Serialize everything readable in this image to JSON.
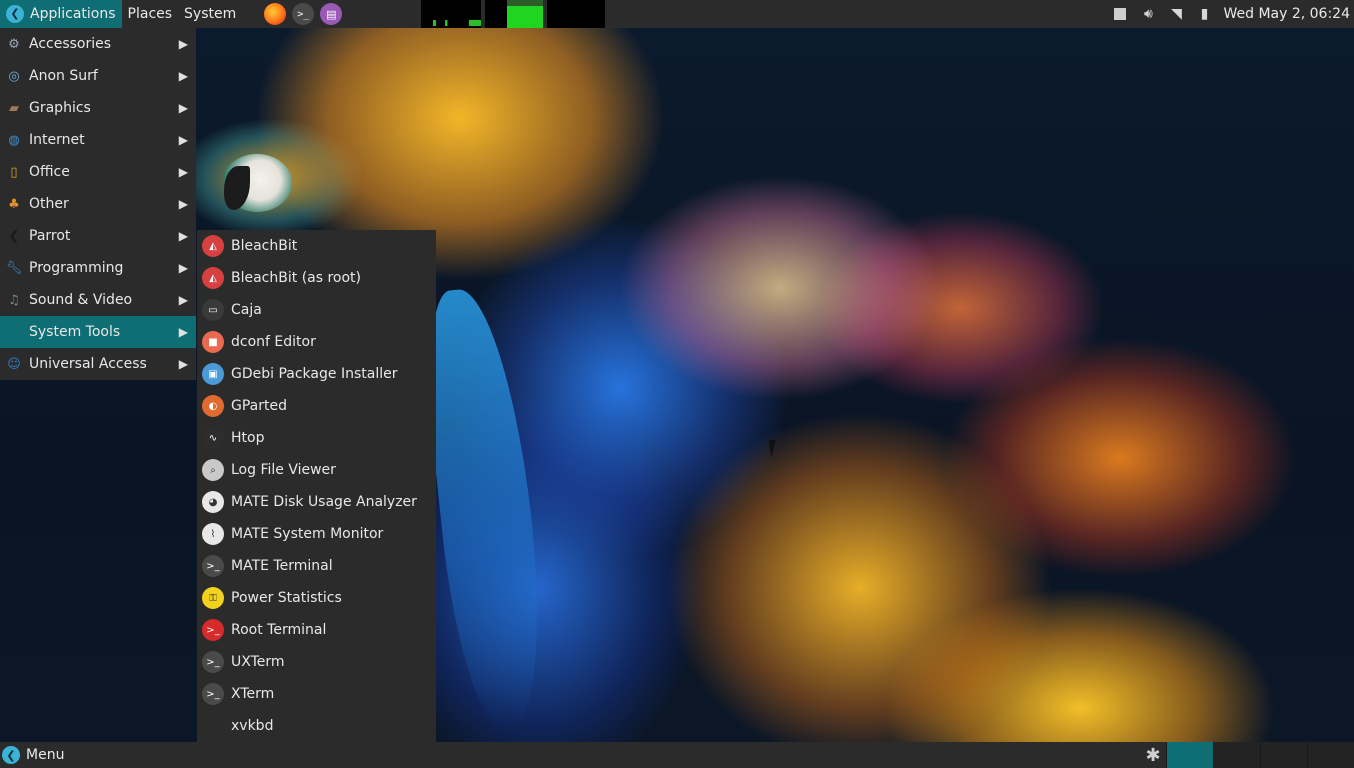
{
  "top_panel": {
    "menus": [
      "Applications",
      "Places",
      "System"
    ],
    "clock": "Wed May  2, 06:24"
  },
  "launchers": [
    "firefox-icon",
    "terminal-icon",
    "text-editor-icon"
  ],
  "app_menu": {
    "categories": [
      {
        "label": "Accessories",
        "icon": "accessories-icon",
        "color": "#9aa8b8"
      },
      {
        "label": "Anon Surf",
        "icon": "anonsurf-icon",
        "color": "#6fb0d8"
      },
      {
        "label": "Graphics",
        "icon": "graphics-icon",
        "color": "#a0785a"
      },
      {
        "label": "Internet",
        "icon": "globe-icon",
        "color": "#3a8fd1"
      },
      {
        "label": "Office",
        "icon": "office-icon",
        "color": "#e0a020"
      },
      {
        "label": "Other",
        "icon": "other-icon",
        "color": "#e09030"
      },
      {
        "label": "Parrot",
        "icon": "parrot-icon",
        "color": "#1a1a1a"
      },
      {
        "label": "Programming",
        "icon": "wrench-icon",
        "color": "#3a8fd1"
      },
      {
        "label": "Sound & Video",
        "icon": "music-icon",
        "color": "#6a8aa0"
      },
      {
        "label": "System Tools",
        "icon": "system-tools-icon",
        "color": "#0e6e73"
      },
      {
        "label": "Universal Access",
        "icon": "accessibility-icon",
        "color": "#2f7fd0"
      }
    ],
    "active_index": 9
  },
  "submenu": {
    "items": [
      {
        "label": "BleachBit",
        "icon": "bleachbit-icon",
        "color": "#d64040"
      },
      {
        "label": "BleachBit (as root)",
        "icon": "bleachbit-root-icon",
        "color": "#d64040"
      },
      {
        "label": "Caja",
        "icon": "caja-icon",
        "color": "#3a3a3a"
      },
      {
        "label": "dconf Editor",
        "icon": "dconf-icon",
        "color": "#e96a50"
      },
      {
        "label": "GDebi Package Installer",
        "icon": "gdebi-icon",
        "color": "#4a9ad8"
      },
      {
        "label": "GParted",
        "icon": "gparted-icon",
        "color": "#e06a30"
      },
      {
        "label": "Htop",
        "icon": "htop-icon",
        "color": "#2d2d2d"
      },
      {
        "label": "Log File Viewer",
        "icon": "log-viewer-icon",
        "color": "#c9c9c9"
      },
      {
        "label": "MATE Disk Usage Analyzer",
        "icon": "disk-usage-icon",
        "color": "#e8e8e8"
      },
      {
        "label": "MATE System Monitor",
        "icon": "system-monitor-icon",
        "color": "#e8e8e8"
      },
      {
        "label": "MATE Terminal",
        "icon": "terminal-icon",
        "color": "#4a4a4a"
      },
      {
        "label": "Power Statistics",
        "icon": "power-icon",
        "color": "#f2d21c"
      },
      {
        "label": "Root Terminal",
        "icon": "root-terminal-icon",
        "color": "#d62b2b"
      },
      {
        "label": "UXTerm",
        "icon": "uxterm-icon",
        "color": "#4a4a4a"
      },
      {
        "label": "XTerm",
        "icon": "xterm-icon",
        "color": "#4a4a4a"
      },
      {
        "label": "xvkbd",
        "icon": "",
        "color": ""
      }
    ]
  },
  "bottom_panel": {
    "menu_label": "Menu"
  }
}
